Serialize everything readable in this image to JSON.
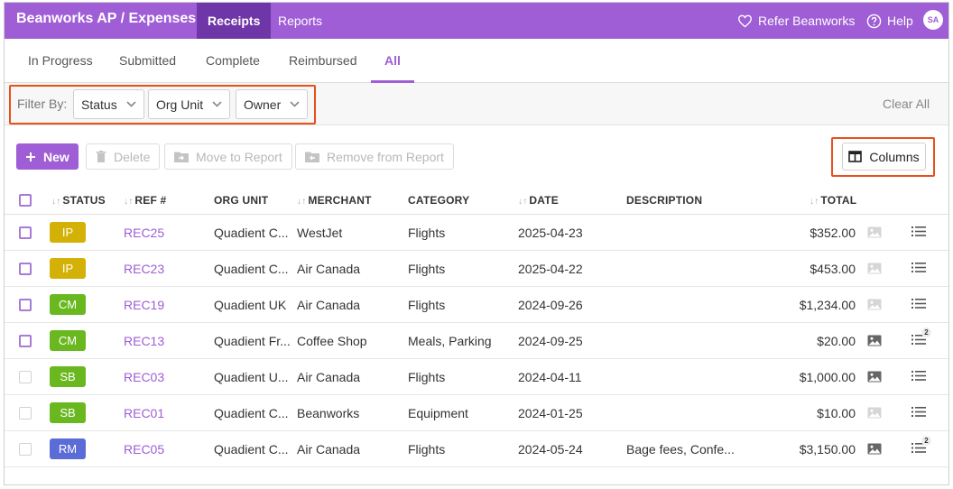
{
  "header": {
    "brand": "Beanworks AP / Expenses",
    "tabs": [
      {
        "label": "Receipts"
      },
      {
        "label": "Reports"
      }
    ],
    "refer_label": "Refer Beanworks",
    "help_label": "Help",
    "avatar_initials": "SA",
    "bar_color": "#9f5dd6",
    "active_tab_color": "#6f36a8"
  },
  "subtabs": [
    {
      "label": "In Progress"
    },
    {
      "label": "Submitted"
    },
    {
      "label": "Complete"
    },
    {
      "label": "Reimbursed"
    },
    {
      "label": "All"
    }
  ],
  "filters": {
    "label": "Filter By:",
    "dropdowns": [
      {
        "label": "Status"
      },
      {
        "label": "Org Unit"
      },
      {
        "label": "Owner"
      }
    ],
    "clear_label": "Clear All"
  },
  "toolbar": {
    "new_label": "New",
    "delete_label": "Delete",
    "move_label": "Move to Report",
    "remove_label": "Remove from Report",
    "columns_label": "Columns"
  },
  "table": {
    "columns": [
      "STATUS",
      "REF #",
      "ORG UNIT",
      "MERCHANT",
      "CATEGORY",
      "DATE",
      "DESCRIPTION",
      "TOTAL"
    ],
    "rows": [
      {
        "status": "IP",
        "status_color": "#d4b106",
        "ref": "REC25",
        "org": "Quadient C...",
        "merchant": "WestJet",
        "category": "Flights",
        "date": "2025-04-23",
        "description": "",
        "total": "$352.00",
        "attachment_icon": "image-icon-light",
        "details_count": ""
      },
      {
        "status": "IP",
        "status_color": "#d4b106",
        "ref": "REC23",
        "org": "Quadient C...",
        "merchant": "Air Canada",
        "category": "Flights",
        "date": "2025-04-22",
        "description": "",
        "total": "$453.00",
        "attachment_icon": "image-icon-light",
        "details_count": ""
      },
      {
        "status": "CM",
        "status_color": "#6ab820",
        "ref": "REC19",
        "org": "Quadient UK",
        "merchant": "Air Canada",
        "category": "Flights",
        "date": "2024-09-26",
        "description": "",
        "total": "$1,234.00",
        "attachment_icon": "image-icon-light",
        "details_count": ""
      },
      {
        "status": "CM",
        "status_color": "#6ab820",
        "ref": "REC13",
        "org": "Quadient Fr...",
        "merchant": "Coffee Shop",
        "category": "Meals, Parking",
        "date": "2024-09-25",
        "description": "",
        "total": "$20.00",
        "attachment_icon": "image-icon",
        "details_count": "2"
      },
      {
        "status": "SB",
        "status_color": "#6ab820",
        "ref": "REC03",
        "org": "Quadient U...",
        "merchant": "Air Canada",
        "category": "Flights",
        "date": "2024-04-11",
        "description": "",
        "total": "$1,000.00",
        "attachment_icon": "image-icon",
        "details_count": ""
      },
      {
        "status": "SB",
        "status_color": "#6ab820",
        "ref": "REC01",
        "org": "Quadient C...",
        "merchant": "Beanworks",
        "category": "Equipment",
        "date": "2024-01-25",
        "description": "",
        "total": "$10.00",
        "attachment_icon": "image-icon-light",
        "details_count": ""
      },
      {
        "status": "RM",
        "status_color": "#5b6cd6",
        "ref": "REC05",
        "org": "Quadient C...",
        "merchant": "Air Canada",
        "category": "Flights",
        "date": "2024-05-24",
        "description": "Bage fees, Confe...",
        "total": "$3,150.00",
        "attachment_icon": "image-icon",
        "details_count": "2"
      }
    ]
  }
}
